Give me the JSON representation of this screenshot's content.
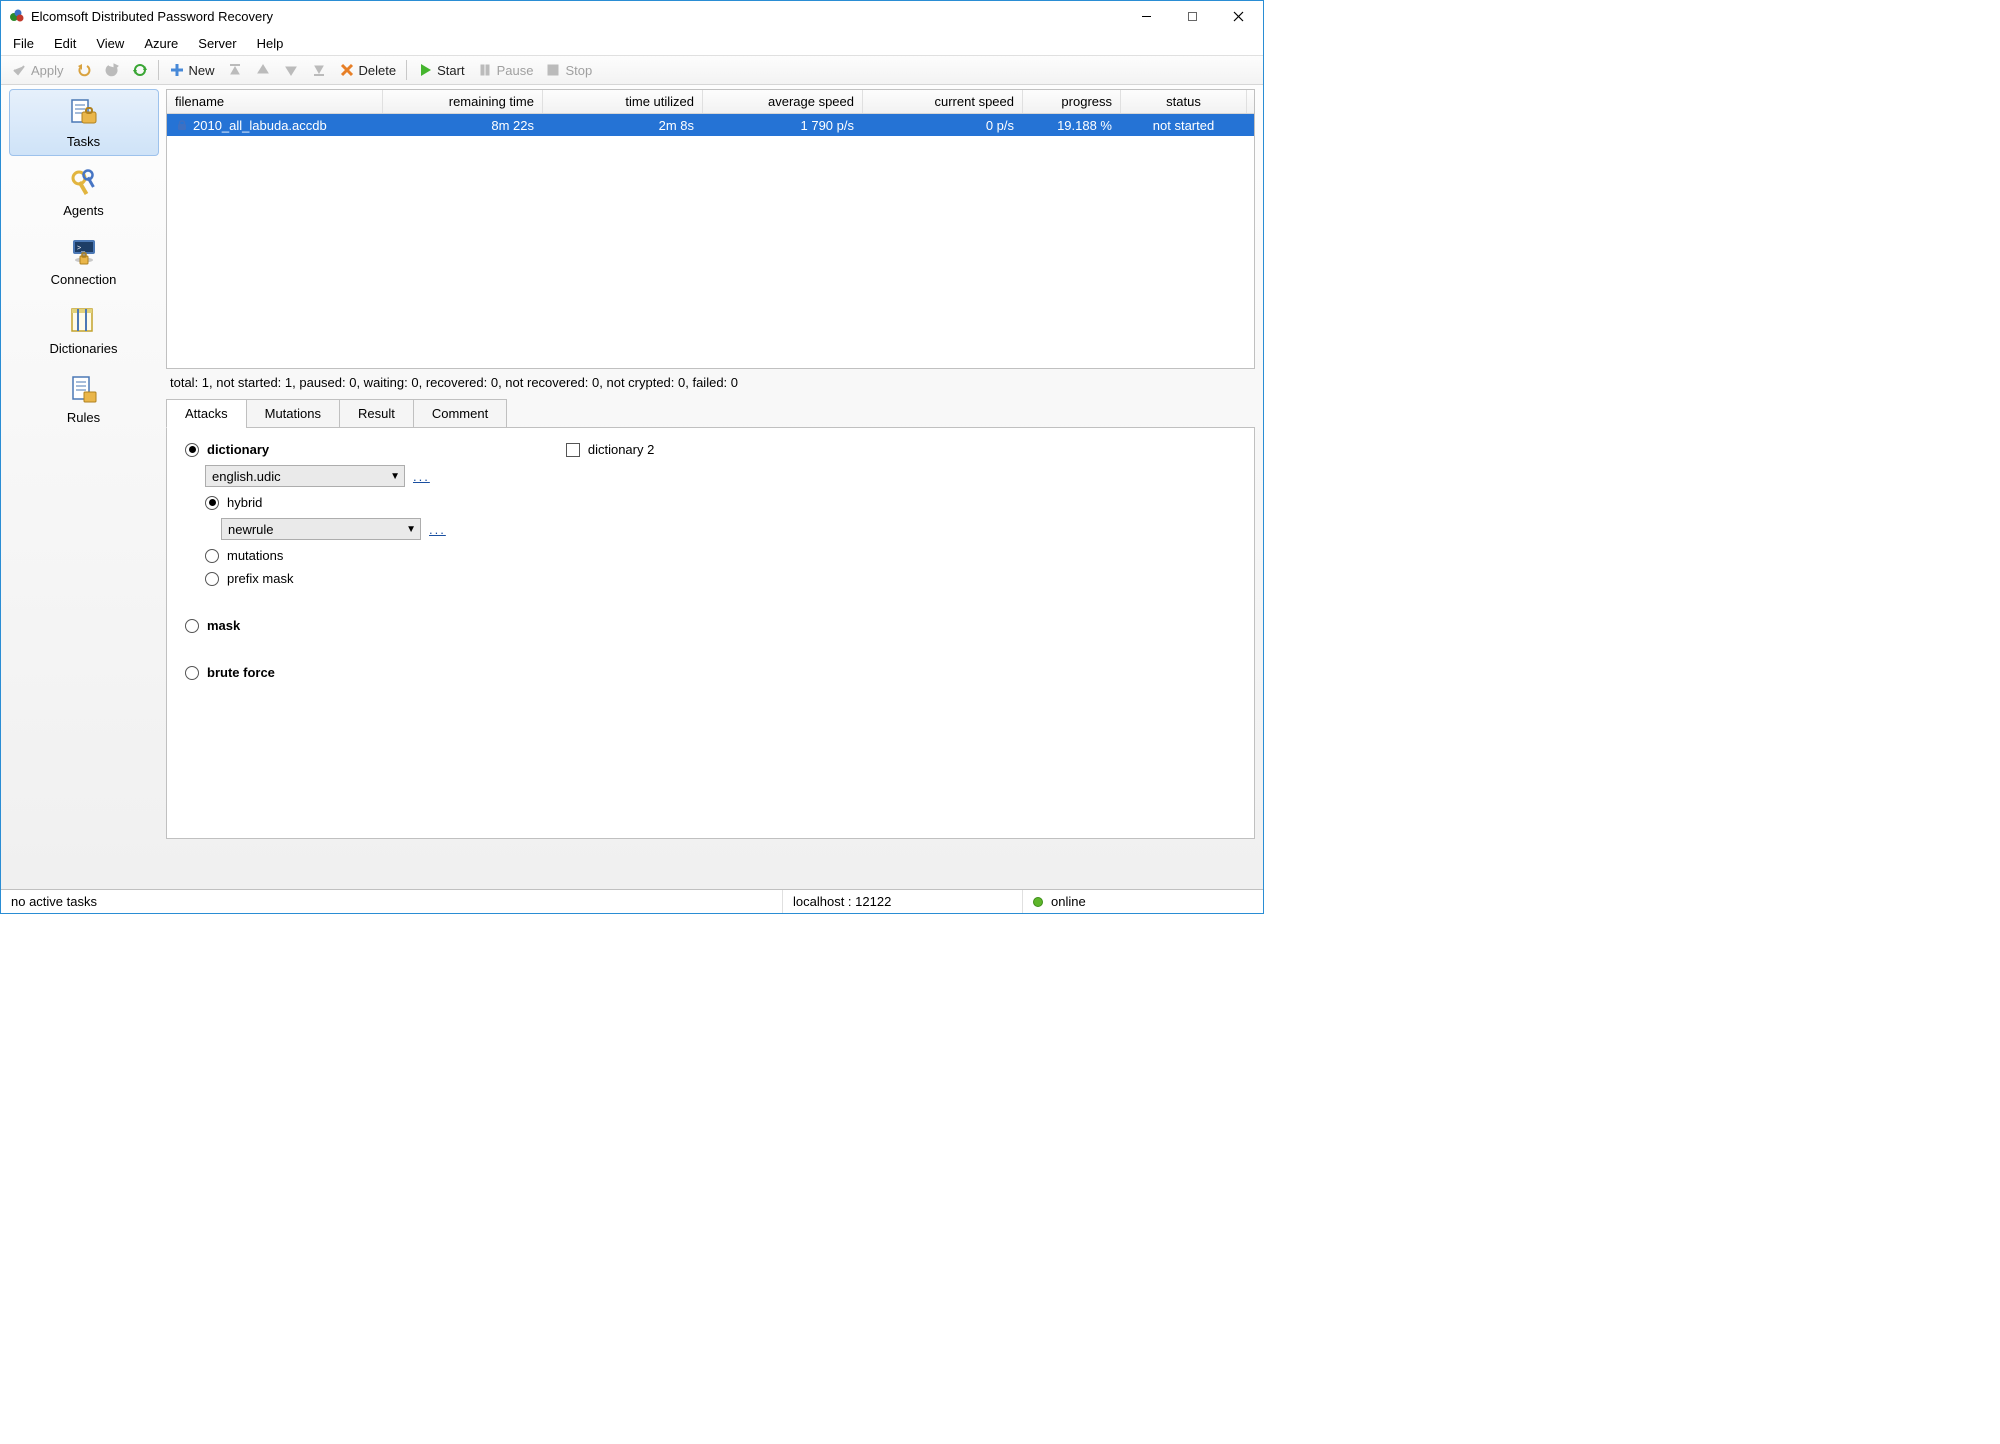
{
  "window": {
    "title": "Elcomsoft Distributed Password Recovery"
  },
  "menu": {
    "items": [
      "File",
      "Edit",
      "View",
      "Azure",
      "Server",
      "Help"
    ]
  },
  "toolbar": {
    "apply": "Apply",
    "new": "New",
    "delete": "Delete",
    "start": "Start",
    "pause": "Pause",
    "stop": "Stop"
  },
  "sidebar": {
    "items": [
      {
        "label": "Tasks"
      },
      {
        "label": "Agents"
      },
      {
        "label": "Connection"
      },
      {
        "label": "Dictionaries"
      },
      {
        "label": "Rules"
      }
    ]
  },
  "table": {
    "headers": {
      "filename": "filename",
      "remaining": "remaining time",
      "utilized": "time utilized",
      "avgspeed": "average speed",
      "curspeed": "current speed",
      "progress": "progress",
      "status": "status"
    },
    "rows": [
      {
        "filename": "2010_all_labuda.accdb",
        "remaining": "8m 22s",
        "utilized": "2m 8s",
        "avgspeed": "1 790  p/s",
        "curspeed": "0  p/s",
        "progress": "19.188 %",
        "status": "not started"
      }
    ]
  },
  "stats_line": "total: 1,   not started: 1,   paused: 0,   waiting: 0,   recovered: 0,   not recovered: 0,   not crypted: 0,   failed: 0",
  "tabs": {
    "items": [
      "Attacks",
      "Mutations",
      "Result",
      "Comment"
    ]
  },
  "attacks": {
    "dictionary_label": "dictionary",
    "dictionary2_label": "dictionary 2",
    "dict_select": "english.udic",
    "hybrid_label": "hybrid",
    "hybrid_select": "newrule",
    "mutations_label": "mutations",
    "prefixmask_label": "prefix mask",
    "mask_label": "mask",
    "bruteforce_label": "brute force",
    "dots": "..."
  },
  "statusbar": {
    "left": "no active tasks",
    "host": "localhost : 12122",
    "status": "online"
  }
}
